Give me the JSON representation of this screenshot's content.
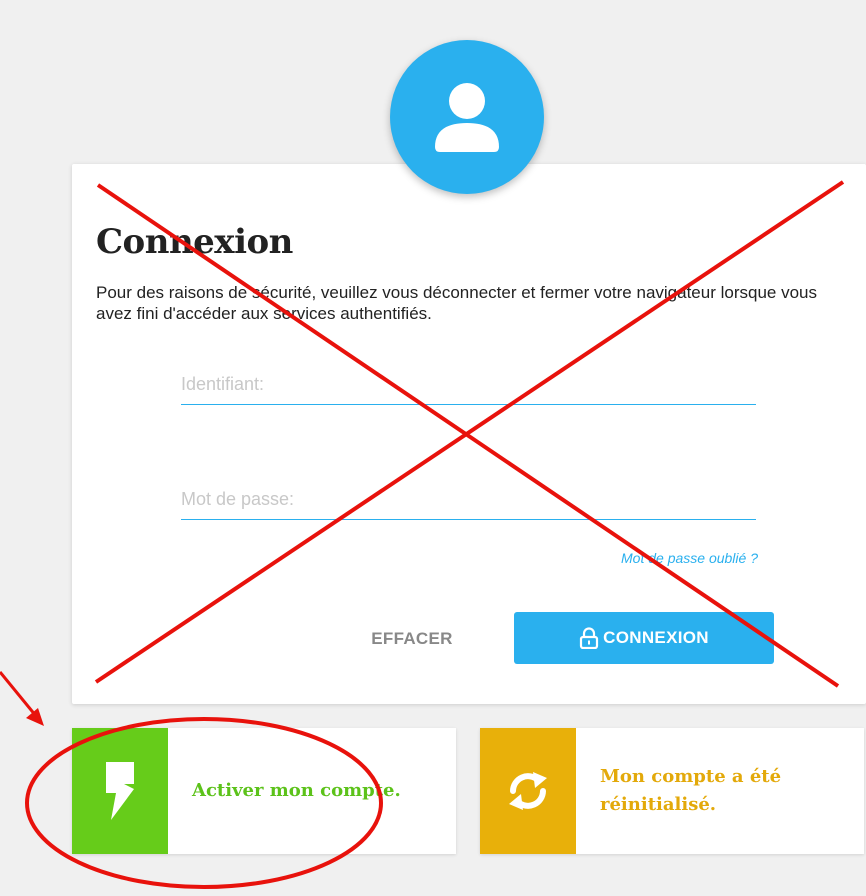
{
  "login": {
    "title": "Connexion",
    "description": "Pour des raisons de sécurité, veuillez vous déconnecter et fermer votre navigateur lorsque vous avez fini d'accéder aux services authentifiés.",
    "username_placeholder": "Identifiant:",
    "password_placeholder": "Mot de passe:",
    "forgot_link": "Mot de passe oublié ?",
    "clear_button": "EFFACER",
    "login_button": "CONNEXION"
  },
  "tiles": {
    "activate_label": "Activer mon compte.",
    "reset_label": "Mon compte a été réinitialisé."
  },
  "icons": {
    "avatar": "user-icon",
    "login_button": "lock-icon",
    "activate": "lightning-bolt-icon",
    "reset": "refresh-icon"
  },
  "colors": {
    "primary": "#2ab0ee",
    "activate": "#66cc1a",
    "reset": "#e8b00a",
    "annotation": "#e8120c"
  }
}
